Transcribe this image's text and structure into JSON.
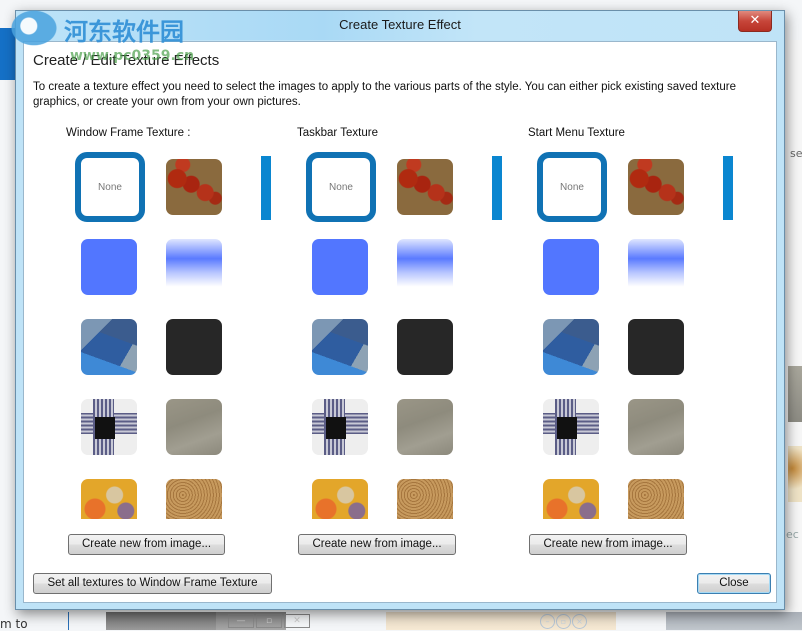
{
  "window": {
    "title": "Create Texture Effect",
    "close_glyph": "✕"
  },
  "heading": "Create / Edit Texture Effects",
  "description": "To create a texture effect you need to select the images to apply to the various parts of the style.  You can either pick existing saved texture graphics, or create your own from your own pictures.",
  "columns": [
    {
      "label": "Window Frame Texture :",
      "none_label": "None",
      "selected": "None",
      "create_button": "Create new from image..."
    },
    {
      "label": "Taskbar Texture",
      "none_label": "None",
      "selected": "None",
      "create_button": "Create new from image..."
    },
    {
      "label": "Start Menu Texture",
      "none_label": "None",
      "selected": "None",
      "create_button": "Create new from image..."
    }
  ],
  "textures": [
    "red-cells",
    "solid-blue",
    "blue-gradient",
    "blue-polygons",
    "dark-gray",
    "checkered-cloth",
    "gray-stone",
    "orange-abstract",
    "sand"
  ],
  "footer": {
    "set_all_button": "Set all textures to Window Frame Texture",
    "close_button": "Close"
  },
  "background": {
    "left_text": "m to",
    "right_text_top": "se",
    "right_text_bottom": "ec",
    "taskbar_buttons": [
      "—",
      "▫",
      "✕"
    ]
  },
  "watermark": {
    "text": "河东软件园",
    "url": "www.pc0359.cn"
  },
  "colors": {
    "selection_border": "#1072b4",
    "scroll_bar": "#0a86d0",
    "title_bg": "#bfe3f7",
    "close_red": "#c7463a"
  }
}
